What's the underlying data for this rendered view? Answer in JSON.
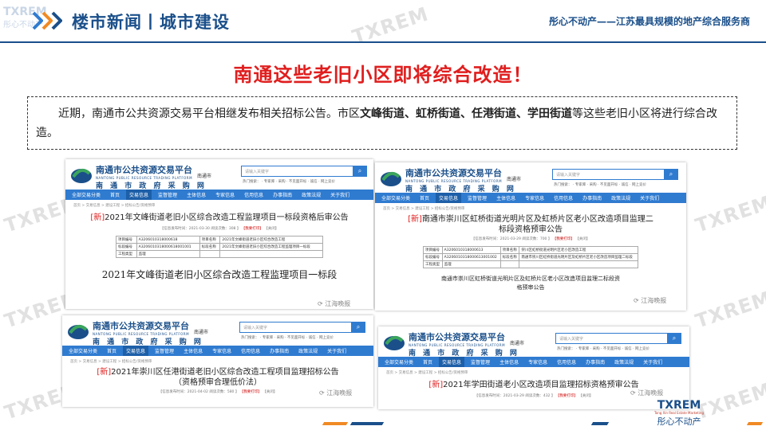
{
  "header": {
    "section_title": "楼市新闻丨城市建设",
    "tagline": "彤心不动产——江苏最具规模的地产综合服务商",
    "watermark_text": "TXREM",
    "watermark_sub": "彤心不动产"
  },
  "headline": "南通这些老旧小区即将综合改造！",
  "intro": {
    "part1": "近期，南通市公共资源交易平台相继发布相关招标公告。市区",
    "highlight": "文峰街道、虹桥街道、任港街道、学田街道",
    "part2": "等这些老旧小区将进行综合改造。"
  },
  "portal": {
    "name": "南通市公共资源交易平台",
    "name_en": "NANTONG PUBLIC RESOURCE TRADING PLATFORM",
    "sub": "南 通 市 政 府 采 购 网",
    "city": "南通市",
    "search_placeholder": "请输入关键字",
    "hot": "热门搜索：  ·  专家库  ·  采购  ·  不见面开标  ·  诚信  ·  网上竞价",
    "nav": [
      "全部交易分类",
      "首页",
      "交易信息",
      "监督管理",
      "主体信息",
      "专家信息",
      "信用信息",
      "办事指南",
      "政策法规",
      "关于我们"
    ],
    "crumbs": "首页 > 交易信息 > 建设工程 > 招标公告/资格预审",
    "print_btn": "【我要打印】",
    "close_btn": "【关闭】"
  },
  "screens": [
    {
      "new_tag": "[新]",
      "title": "2021年文峰街道老旧小区综合改造工程监理项目一标段资格后审公告",
      "meta": "【信息发布时间：2021-03-30 阅读次数：308 】",
      "rows": [
        [
          "项目编号",
          "A3206010318000618",
          "项目名称",
          "2021年文峰街道老旧小区综合改造工程"
        ],
        [
          "标段编号",
          "A3206010318000618001001",
          "标段名称",
          "2021年文峰街道老旧小区综合改造工程监理项目一标段"
        ],
        [
          "工程类型",
          "监理",
          "",
          ""
        ]
      ],
      "doc": "2021年文峰街道老旧小区综合改造工程监理项目一标段"
    },
    {
      "new_tag": "[新]",
      "title": "南通市崇川区虹桥街道光明片区及虹桥片区老小区改造项目监理二标段资格预审公告",
      "meta": "【信息发布时间：2021-03-29 阅读次数：700 】",
      "rows": [
        [
          "项目编号",
          "A3206010318000613",
          "项目名称",
          "崇川区虹桥街道光明片区老小区改造工程"
        ],
        [
          "标段编号",
          "A3206010318000613001002",
          "标段名称",
          "南通市崇川区虹桥街道光明片区及虹桥片区老小区改造项目监理二标段"
        ],
        [
          "工程类型",
          "监理",
          "",
          ""
        ]
      ],
      "doc": "南通市崇川区虹桥街道光明片区及虹桥片区老小区改造项目监理二标段资格预审公告"
    },
    {
      "new_tag": "[新]",
      "title": "2021年崇川区任港街道老旧小区综合改造工程项目监理招标公告（资格预审合理低价法）",
      "meta": "【信息发布时间：2021-04-02 阅读次数：580 】"
    },
    {
      "new_tag": "[新]",
      "title": "2021年学田街道老小区改造项目监理招标资格预审公告",
      "meta": "【信息发布时间：2021-03-29 阅读次数：432 】"
    }
  ],
  "wechat_label": "江海晚报",
  "footer_brand": {
    "logo": "TXREM",
    "en": "Tong Xin Real Estate Marketing",
    "cn": "彤心不动产"
  },
  "colors": {
    "brand_blue": "#1a4f8a",
    "headline_red": "#e01e1e",
    "nav_blue": "#2f7bd0",
    "accent_orange": "#f08a24"
  }
}
